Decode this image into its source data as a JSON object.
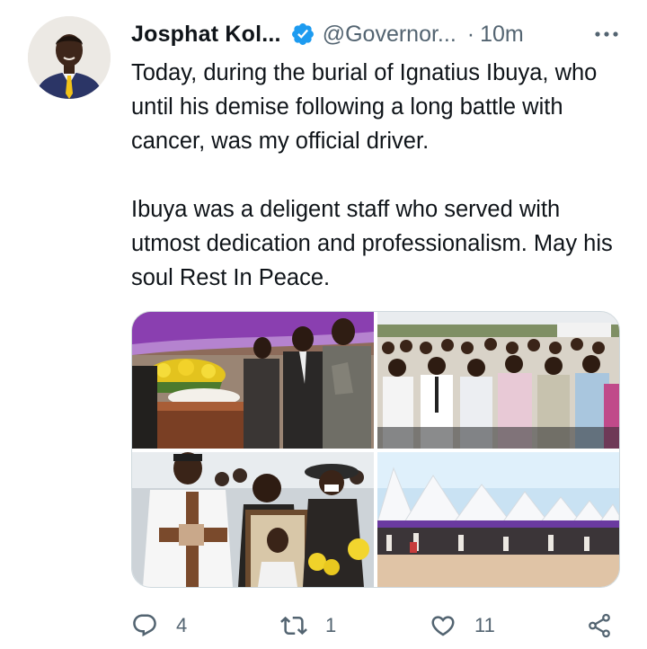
{
  "tweet": {
    "author": {
      "display_name": "Josphat Kol...",
      "handle": "@Governor...",
      "verified": true
    },
    "separator": "·",
    "timestamp": "10m",
    "paragraphs": [
      "Today, during the burial of Ignatius Ibuya, who until his demise following a long battle with cancer, was my official driver.",
      "Ibuya was a deligent staff who served with utmost dedication and professionalism. May his soul Rest In Peace."
    ],
    "media": [
      {
        "subject": "casket-with-yellow-flowers-and-mourners"
      },
      {
        "subject": "mourners-standing-in-prayer"
      },
      {
        "subject": "man-holding-cross-and-portrait"
      },
      {
        "subject": "white-tents-at-burial-site"
      }
    ],
    "actions": {
      "replies": "4",
      "retweets": "1",
      "likes": "11"
    }
  },
  "colors": {
    "text": "#0f1419",
    "secondary": "#536471",
    "verified": "#1d9bf0",
    "border": "#cfd9de"
  },
  "icons": {
    "more": "more-horizontal-icon",
    "verified": "verified-badge-icon",
    "reply": "reply-icon",
    "retweet": "retweet-icon",
    "like": "heart-icon",
    "share": "share-icon"
  }
}
